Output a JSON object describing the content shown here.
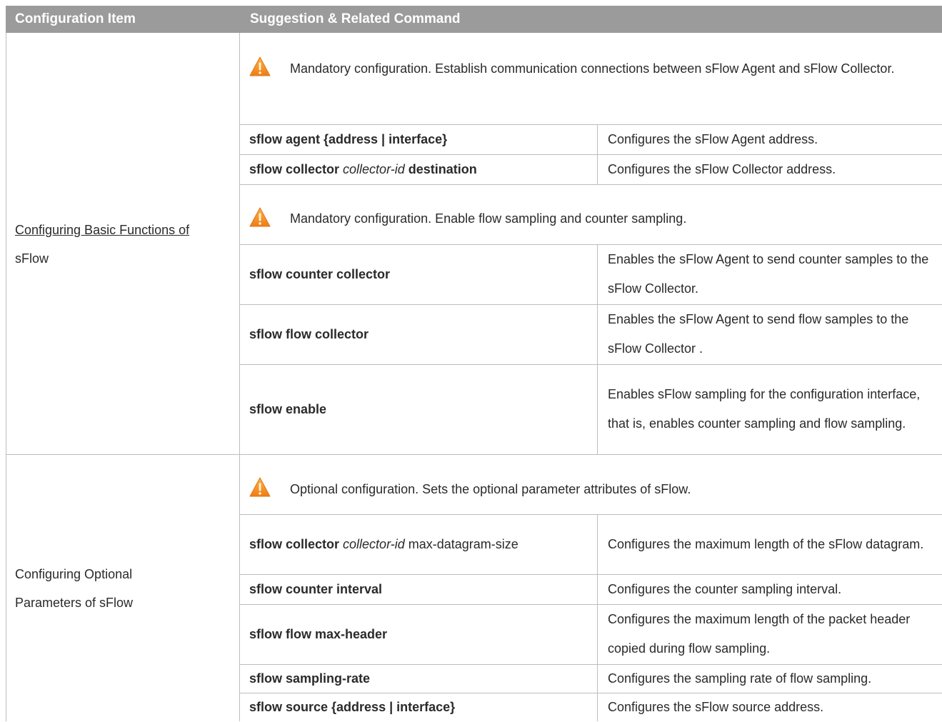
{
  "header": {
    "col1": "Configuration Item",
    "col2": "Suggestion & Related Command"
  },
  "sections": [
    {
      "item": [
        "Configuring Basic Functions of ",
        "sFlow"
      ],
      "notes": [
        "Mandatory configuration. Establish communication connections between sFlow Agent and sFlow Collector.",
        "Mandatory configuration. Enable flow sampling and counter sampling."
      ],
      "rows": [
        {
          "cmd_b1": "sflow agent {address | interface}",
          "cmd_i": "",
          "cmd_b2": "",
          "cmd_n": "",
          "desc": "Configures the sFlow Agent address."
        },
        {
          "cmd_b1": "sflow collector ",
          "cmd_i": "collector-id",
          "cmd_b2": " destination",
          "cmd_n": "",
          "desc": "Configures the sFlow Collector address."
        },
        {
          "cmd_b1": "sflow counter collector",
          "desc": "Enables the sFlow Agent to send counter samples to the sFlow Collector."
        },
        {
          "cmd_b1": "sflow flow collector",
          "desc": "Enables the sFlow Agent to send flow samples to the sFlow Collector ."
        },
        {
          "cmd_b1": "sflow enable",
          "desc": "Enables sFlow sampling for the configuration interface, that is, enables counter sampling and flow sampling."
        }
      ]
    },
    {
      "item": [
        "Configuring Optional ",
        "Parameters of sFlow"
      ],
      "notes": [
        "Optional configuration. Sets the optional parameter attributes of sFlow."
      ],
      "rows": [
        {
          "cmd_b1": "sflow collector ",
          "cmd_i": "collector-id",
          "cmd_b2": "",
          "cmd_n": " max-datagram-size",
          "desc": "Configures the maximum length of the sFlow datagram."
        },
        {
          "cmd_b1": "sflow counter interval",
          "desc": "Configures the counter sampling interval."
        },
        {
          "cmd_b1": "sflow flow max-header",
          "desc": "Configures the maximum length of the packet header copied during flow sampling."
        },
        {
          "cmd_b1": "sflow sampling-rate",
          "desc": "Configures the sampling rate of flow sampling."
        },
        {
          "cmd_b1": "sflow source {address | interface}",
          "desc": "Configures the sFlow source address."
        }
      ]
    }
  ],
  "colors": {
    "header_bg": "#9b9b9b",
    "warning": "#f39a1e",
    "grid": "#bdbdbd"
  }
}
